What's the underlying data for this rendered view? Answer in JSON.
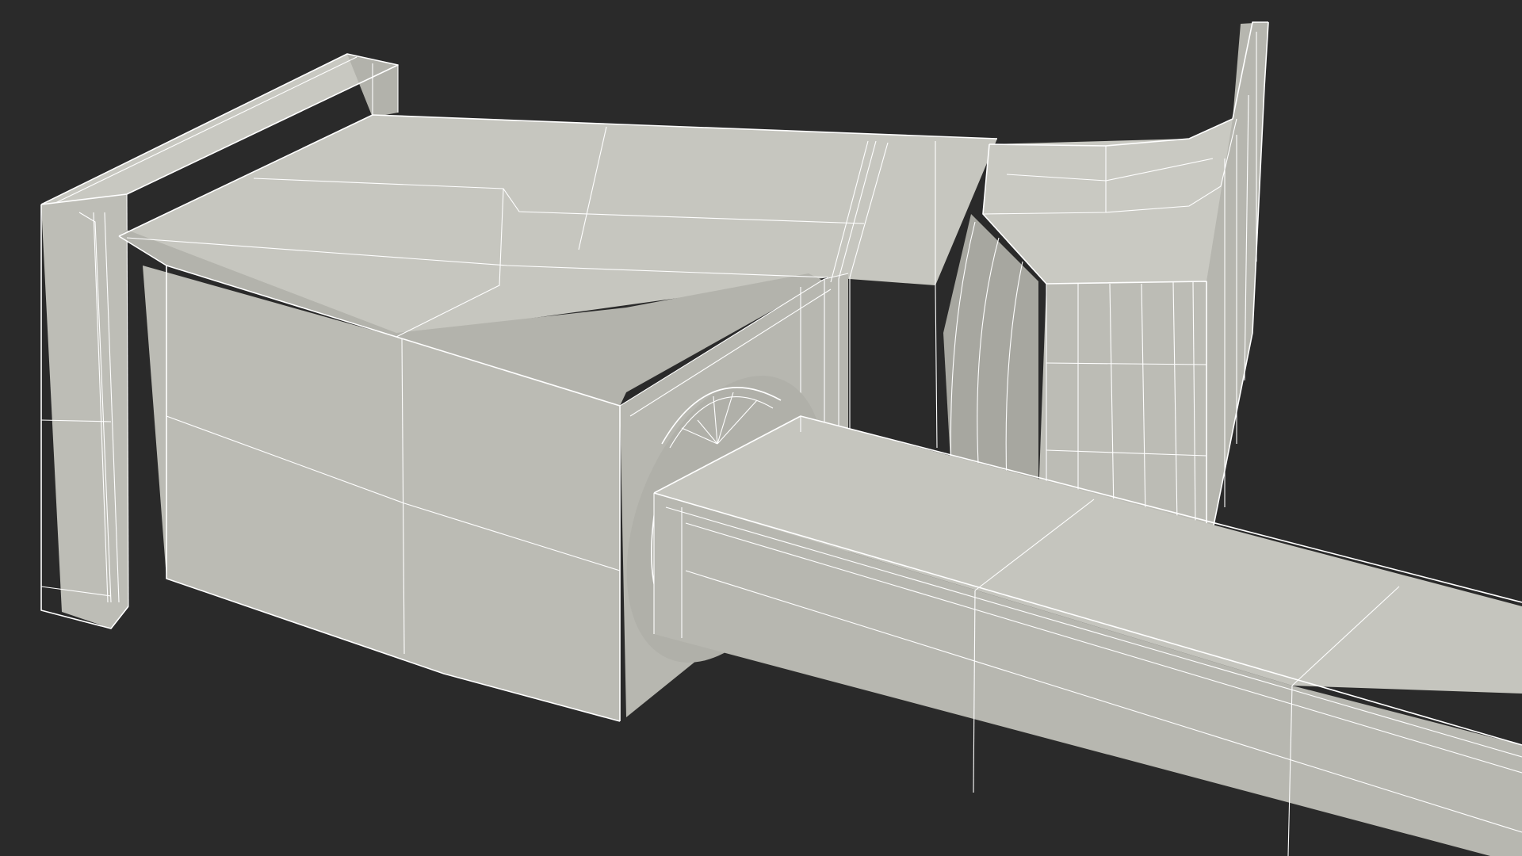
{
  "scene": {
    "background_color": "#2a2a2a",
    "surface_light": "#c4c4bd",
    "surface_mid": "#b9b9b2",
    "surface_dark": "#a9a9a2",
    "wire_color": "#ffffff"
  }
}
